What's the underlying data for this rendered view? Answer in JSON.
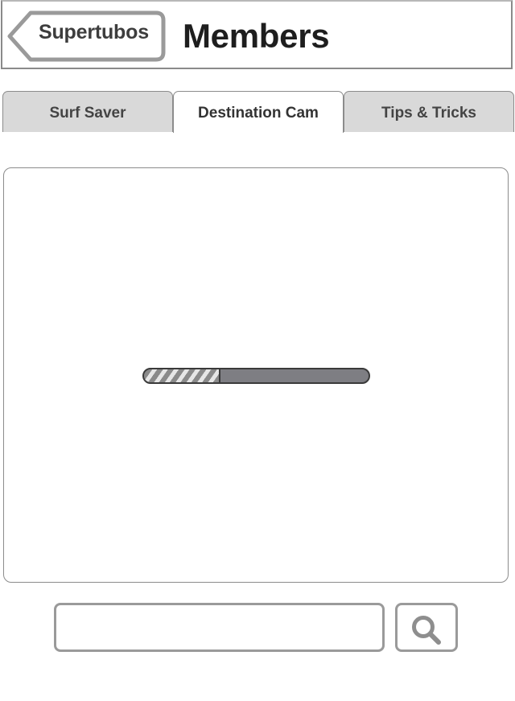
{
  "header": {
    "back_label": "Supertubos",
    "title": "Members"
  },
  "tabs": [
    {
      "label": "Surf Saver",
      "active": false
    },
    {
      "label": "Destination Cam",
      "active": true
    },
    {
      "label": "Tips & Tricks",
      "active": false
    }
  ],
  "content": {
    "loading_progress": 0.34
  },
  "search": {
    "value": "",
    "placeholder": "",
    "button_icon": "search-icon"
  },
  "colors": {
    "tab_inactive": "#d9d9d9",
    "tab_active": "#ffffff",
    "border": "#8c8c8c",
    "progress_track": "#7e7e83"
  }
}
